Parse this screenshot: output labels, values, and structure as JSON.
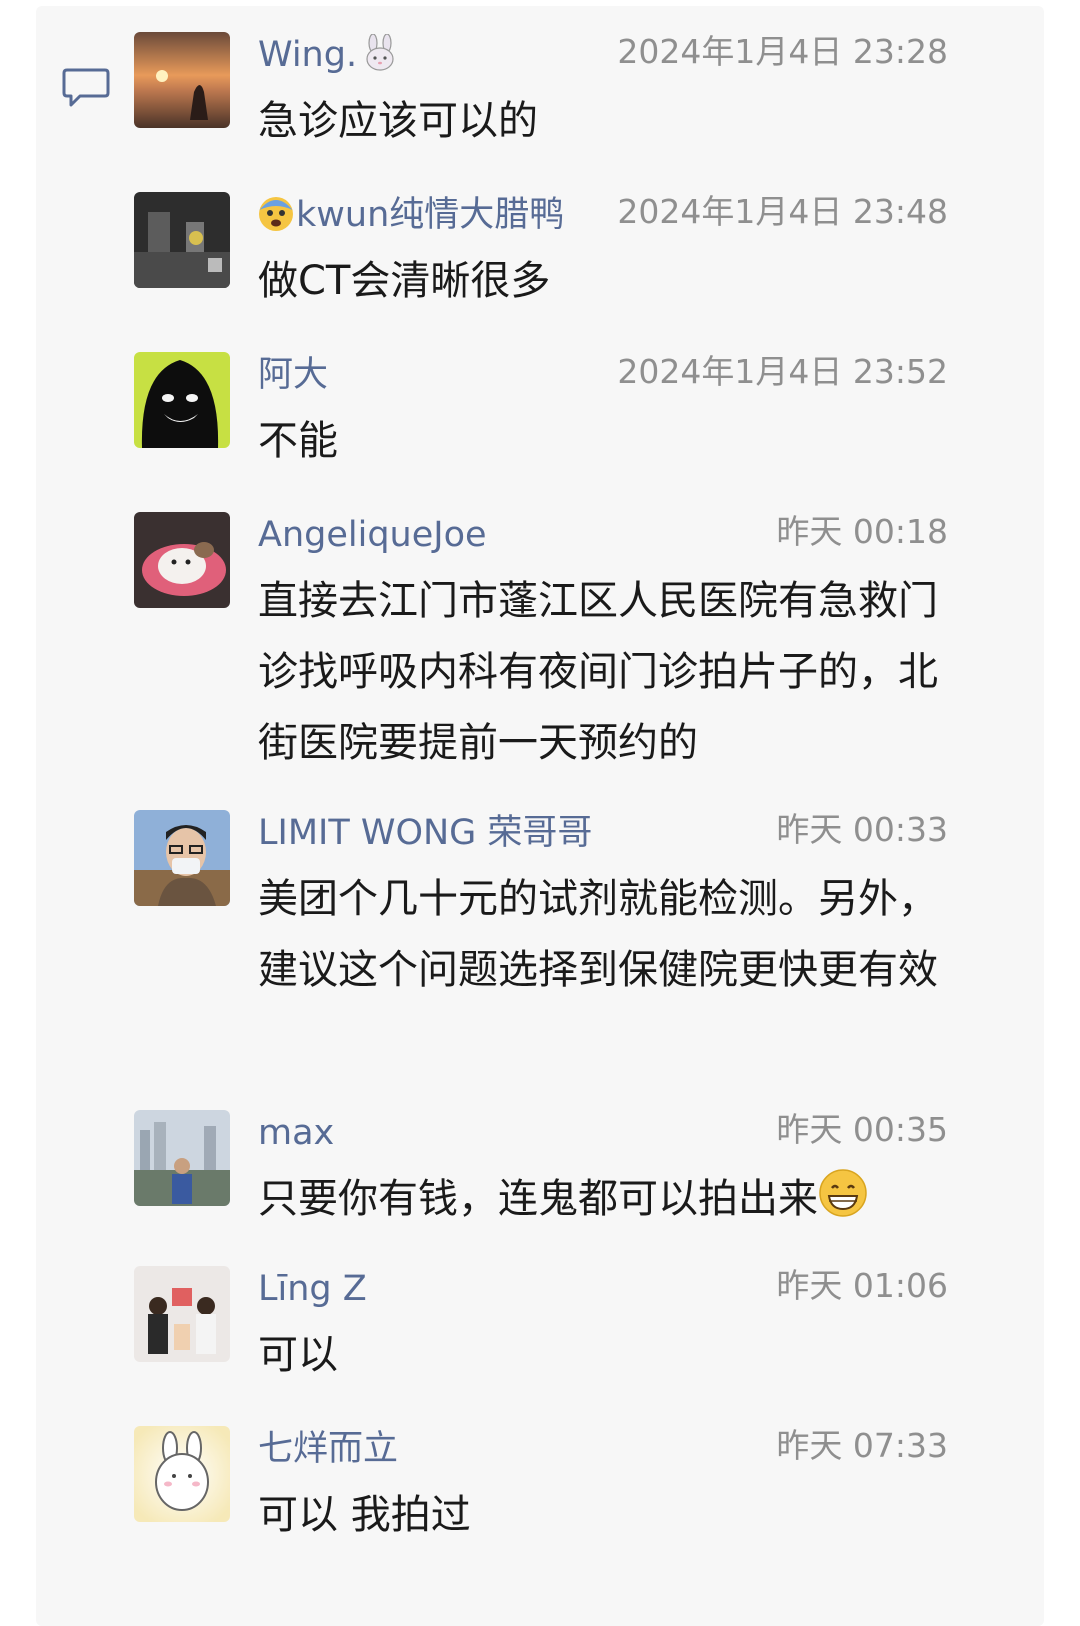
{
  "comments": [
    {
      "name": "Wing.",
      "name_suffix_icon": "bunny-emoji-icon",
      "time": "2024年1月4日 23:28",
      "text": "急诊应该可以的"
    },
    {
      "name": "kwun纯情大腊鸭",
      "name_prefix_icon": "fearful-face-emoji-icon",
      "time": "2024年1月4日 23:48",
      "text": "做CT会清晰很多"
    },
    {
      "name": "阿大",
      "time": "2024年1月4日 23:52",
      "text": "不能"
    },
    {
      "name": "AngeliqueJoe",
      "time": "昨天 00:18",
      "text": "直接去江门市蓬江区人民医院有急救门诊找呼吸内科有夜间门诊拍片子的，北街医院要提前一天预约的"
    },
    {
      "name": "LIMIT WONG 荣哥哥",
      "time": "昨天 00:33",
      "text": "美团个几十元的试剂就能检测。另外，建议这个问题选择到保健院更快更有效"
    },
    {
      "name": "max",
      "time": "昨天 00:35",
      "text": "只要你有钱，连鬼都可以拍出来",
      "text_suffix_icon": "grinning-emoji-icon"
    },
    {
      "name": "Līng Z",
      "time": "昨天 01:06",
      "text": "可以"
    },
    {
      "name": "七烊而立",
      "time": "昨天 07:33",
      "text": "可以 我拍过"
    }
  ],
  "colors": {
    "name": "#576b95",
    "time": "#8f8f8f",
    "text": "#1a1a1a",
    "panel": "#f7f7f7"
  }
}
